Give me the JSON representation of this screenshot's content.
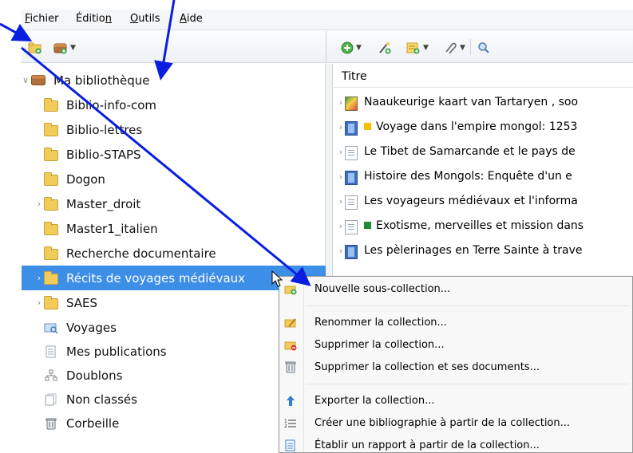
{
  "menubar": {
    "items": [
      {
        "label": "Fichier",
        "underline": "F",
        "rest": "ichier"
      },
      {
        "label": "Édition",
        "pre": "Éditio",
        "underline": "n",
        "rest": ""
      },
      {
        "label": "Outils",
        "underline": "O",
        "rest": "utils"
      },
      {
        "label": "Aide",
        "underline": "A",
        "rest": "ide"
      }
    ]
  },
  "toolbar": {
    "left_icons": [
      "new-collection-icon",
      "new-library-icon"
    ],
    "right_icons": [
      "new-item-icon",
      "add-by-identifier-icon",
      "new-note-icon",
      "attachment-icon",
      "search-icon"
    ]
  },
  "tree": {
    "library_label": "Ma bibliothèque",
    "items": [
      {
        "label": "Biblio-info-com",
        "expandable": false
      },
      {
        "label": "Biblio-lettres",
        "expandable": false
      },
      {
        "label": "Biblio-STAPS",
        "expandable": false
      },
      {
        "label": "Dogon",
        "expandable": false
      },
      {
        "label": "Master_droit",
        "expandable": true
      },
      {
        "label": "Master1_italien",
        "expandable": false
      },
      {
        "label": "Recherche documentaire",
        "expandable": false
      },
      {
        "label": "Récits de voyages médiévaux",
        "expandable": true,
        "selected": true
      },
      {
        "label": "SAES",
        "expandable": true
      }
    ],
    "special": [
      {
        "label": "Voyages",
        "icon": "saved-search-icon"
      },
      {
        "label": "Mes publications",
        "icon": "publications-icon"
      },
      {
        "label": "Doublons",
        "icon": "duplicates-icon"
      },
      {
        "label": "Non classés",
        "icon": "unfiled-icon"
      },
      {
        "label": "Corbeille",
        "icon": "trash-icon"
      }
    ]
  },
  "items_pane": {
    "column_title": "Titre",
    "rows": [
      {
        "title": "Naaukeurige kaart van Tartaryen , soo",
        "icon": "map-icon",
        "tag": ""
      },
      {
        "title": "Voyage dans l'empire mongol: 1253",
        "icon": "book-icon",
        "tag": "#f2c200"
      },
      {
        "title": "Le Tibet de Samarcande et le pays de",
        "icon": "document-icon",
        "tag": ""
      },
      {
        "title": "Histoire des Mongols: Enquête d'un e",
        "icon": "book-icon",
        "tag": ""
      },
      {
        "title": "Les voyageurs médiévaux et l'informa",
        "icon": "document-icon",
        "tag": ""
      },
      {
        "title": "Exotisme, merveilles et mission dans",
        "icon": "document-icon",
        "tag": "#1e8c3a"
      },
      {
        "title": "Les pèlerinages en Terre Sainte à trave",
        "icon": "book-icon",
        "tag": ""
      }
    ]
  },
  "context_menu": {
    "items": [
      {
        "label": "Nouvelle sous-collection...",
        "icon": "new-subcollection-icon"
      },
      {
        "label": "Renommer la collection...",
        "icon": "rename-icon"
      },
      {
        "label": "Supprimer la collection...",
        "icon": "delete-collection-icon"
      },
      {
        "label": "Supprimer la collection et ses documents...",
        "icon": "delete-with-items-icon"
      },
      {
        "label": "Exporter la collection...",
        "icon": "export-icon"
      },
      {
        "label": "Créer une bibliographie à partir de la collection...",
        "icon": "bibliography-icon"
      },
      {
        "label": "Établir un rapport à partir de la collection...",
        "icon": "report-icon"
      }
    ]
  },
  "colors": {
    "selection": "#3d8ee7",
    "annotation_arrow": "#0a1ee0",
    "folder": "#f2cc5a"
  }
}
